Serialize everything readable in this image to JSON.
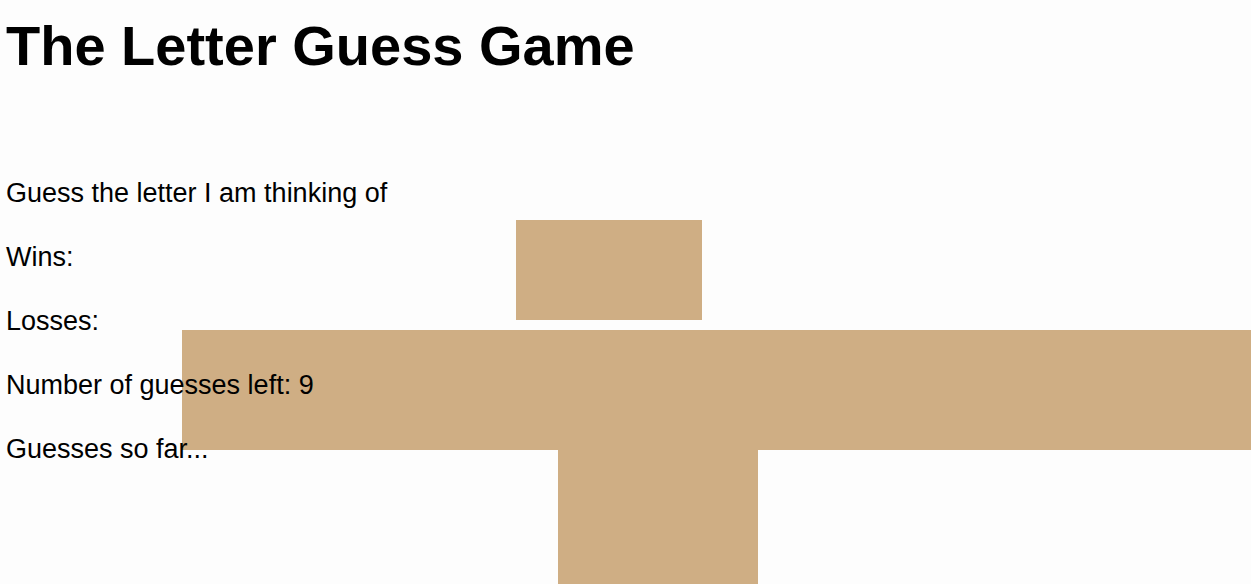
{
  "title": "The Letter Guess Game",
  "prompt": "Guess the letter I am thinking of",
  "stats": [
    {
      "label": "Wins:"
    },
    {
      "label": "Losses:"
    },
    {
      "label": "Number of guesses left:",
      "value": "9"
    },
    {
      "label": "Guesses so far..."
    }
  ]
}
